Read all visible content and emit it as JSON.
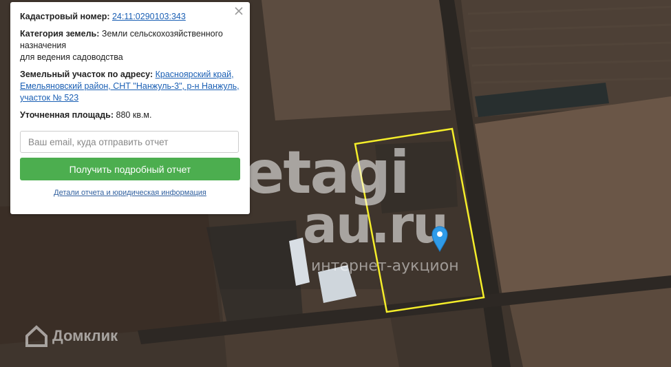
{
  "popup": {
    "cadastral_label": "Кадастровый номер:",
    "cadastral_value": "24:11:0290103:343",
    "category_label": "Категория земель:",
    "category_value_1": "Земли сельскохозяйственного",
    "category_value_2": "назначения",
    "category_value_3": "для ведения садоводства",
    "address_label": "Земельный участок по адресу:",
    "address_line_1": "Красноярский край,",
    "address_line_2": "Емельяновский район, СНТ \"Нанжуль-3\", р-н Нанжуль,",
    "address_line_3": "участок № 523",
    "area_label": "Уточненная площадь:",
    "area_value": "880 кв.м.",
    "email_placeholder": "Ваш email, куда отправить отчет",
    "report_button": "Получить подробный отчет",
    "details_link": "Детали отчета и юридическая информация"
  },
  "watermarks": {
    "etagi": "etagi",
    "au": "au.ru",
    "auction": "интернет-аукцион",
    "domclick": "Домклик"
  },
  "map": {
    "parcel_outline_color": "#f5ee2a",
    "marker_color": "#2f9be8",
    "icons": [
      "map-pin-icon",
      "close-icon",
      "domclick-logo-icon"
    ]
  }
}
